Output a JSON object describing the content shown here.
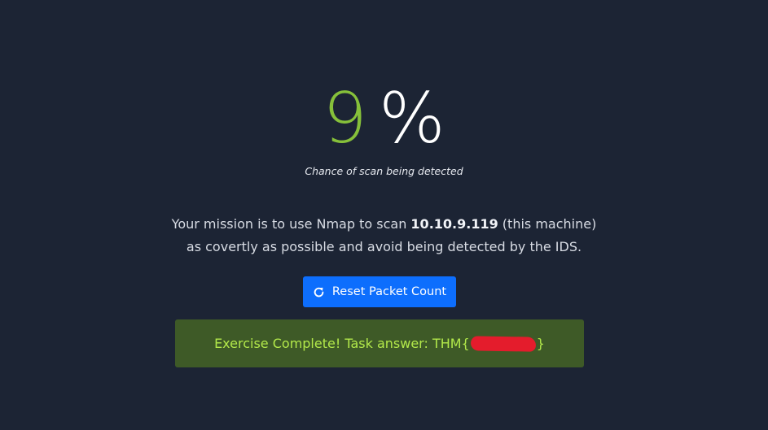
{
  "detection": {
    "value": "9",
    "sign": "%",
    "caption": "Chance of scan being detected",
    "value_color": "#86c03a"
  },
  "mission": {
    "text_before": "Your mission is to use Nmap to scan ",
    "ip": "10.10.9.119",
    "text_after": " (this machine)",
    "line2": "as covertly as possible and avoid being detected by the IDS."
  },
  "reset_button": {
    "icon": "refresh-icon",
    "label": "Reset Packet Count",
    "color": "#0d6efd"
  },
  "result": {
    "text_before": "Exercise Complete! Task answer: THM{",
    "text_after": "}",
    "background": "#3e5a27",
    "text_color": "#b2e84a"
  }
}
